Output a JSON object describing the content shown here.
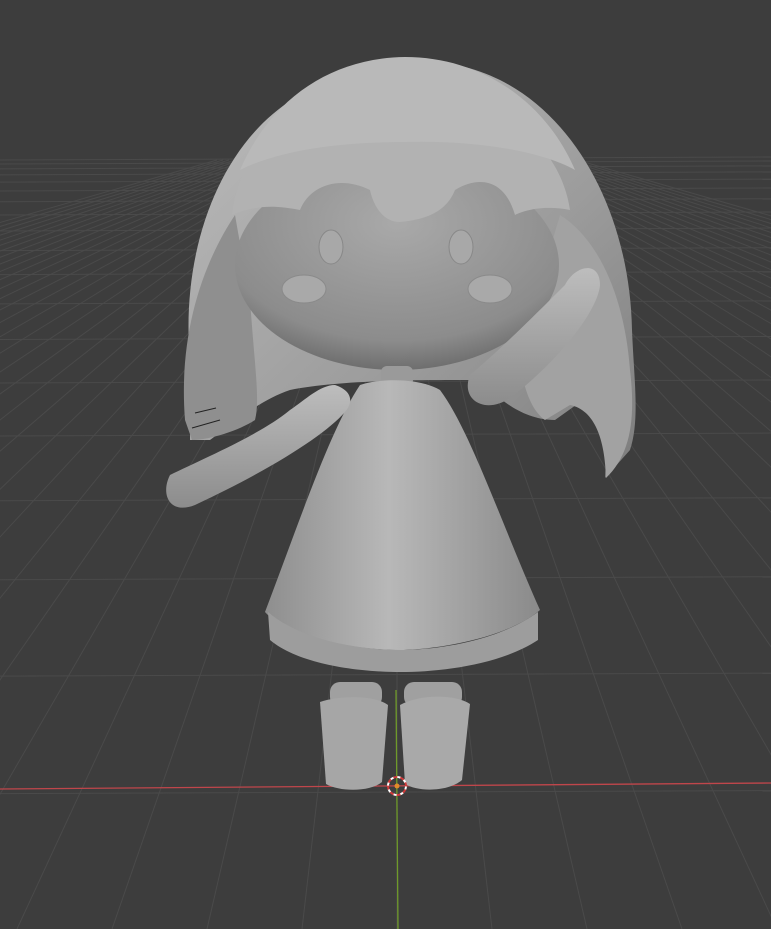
{
  "viewport": {
    "kind": "3D viewport",
    "shading": "solid",
    "background_color": "#3d3d3d",
    "grid_line_color": "#4a4a4a",
    "x_axis_color": "#c0464b",
    "y_axis_color": "#6f9a2a",
    "model_color": "#a6a6a6",
    "icons": {
      "cursor": "3d-cursor-icon",
      "origin": "origin-point-icon"
    }
  }
}
